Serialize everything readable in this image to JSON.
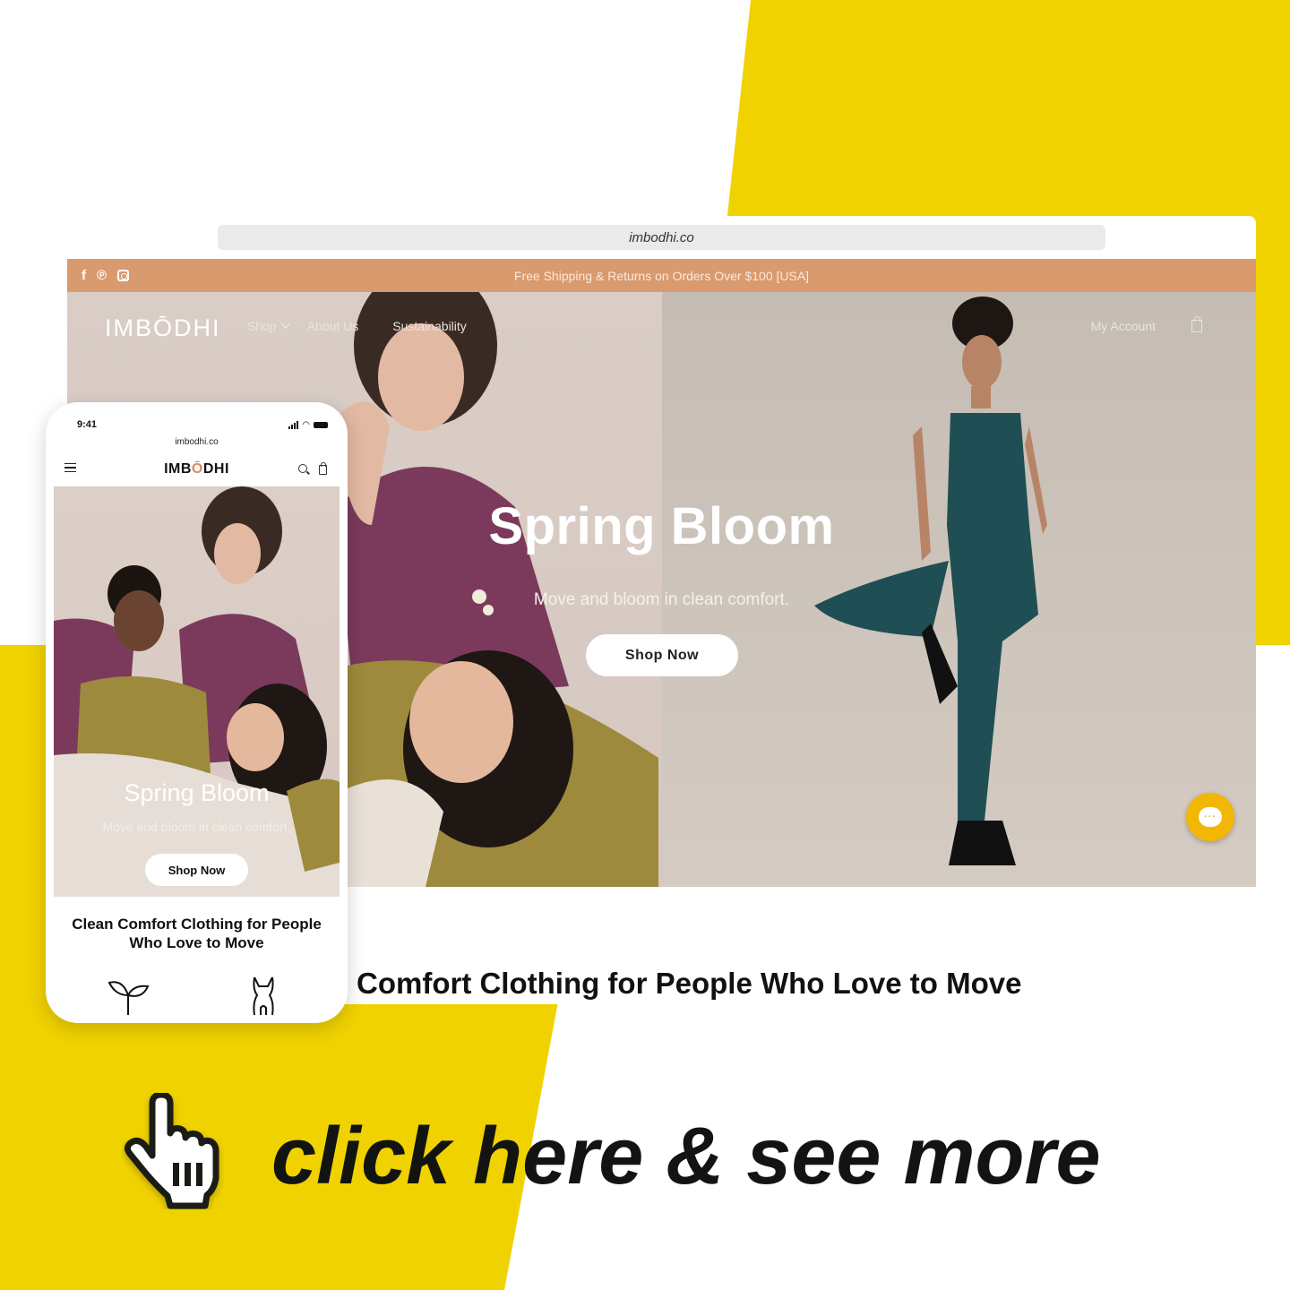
{
  "colors": {
    "accent_yellow": "#F0D200",
    "announcement_bar": "#D99A6E",
    "chat_button": "#F2B705",
    "logo_accent": "#D98A5F",
    "text_dark": "#111111"
  },
  "browser": {
    "url": "imbodhi.co",
    "announcement": {
      "text": "Free Shipping & Returns on Orders Over $100 [USA]",
      "social_icons": [
        "facebook-icon",
        "pinterest-icon",
        "instagram-icon"
      ]
    },
    "nav": {
      "logo": "IMBŌDHI",
      "links": [
        {
          "label": "Shop",
          "has_dropdown": true
        },
        {
          "label": "About Us"
        },
        {
          "label": "Sustainability"
        }
      ],
      "account_label": "My Account",
      "cart_icon": "shopping-bag-icon"
    },
    "hero": {
      "title": "Spring Bloom",
      "subtitle": "Move and bloom in clean comfort.",
      "button_label": "Shop Now"
    },
    "chat_icon": "chat-bubble-icon",
    "chat_dots": "···",
    "tagline": "Comfort Clothing for People Who Love to Move"
  },
  "phone": {
    "time": "9:41",
    "url": "imbodhi.co",
    "logo_prefix": "IMB",
    "logo_accent_letter": "Ō",
    "logo_suffix": "DHI",
    "hero": {
      "title": "Spring Bloom",
      "subtitle": "Move and bloom in clean comfort.",
      "button_label": "Shop Now"
    },
    "heading_line1": "Clean Comfort Clothing for People",
    "heading_line2": "Who Love to Move",
    "feature_icons": [
      "sprout-icon",
      "bodysuit-icon"
    ]
  },
  "cta": {
    "text": "click here & see more",
    "icon": "pointing-hand-cursor-icon"
  }
}
